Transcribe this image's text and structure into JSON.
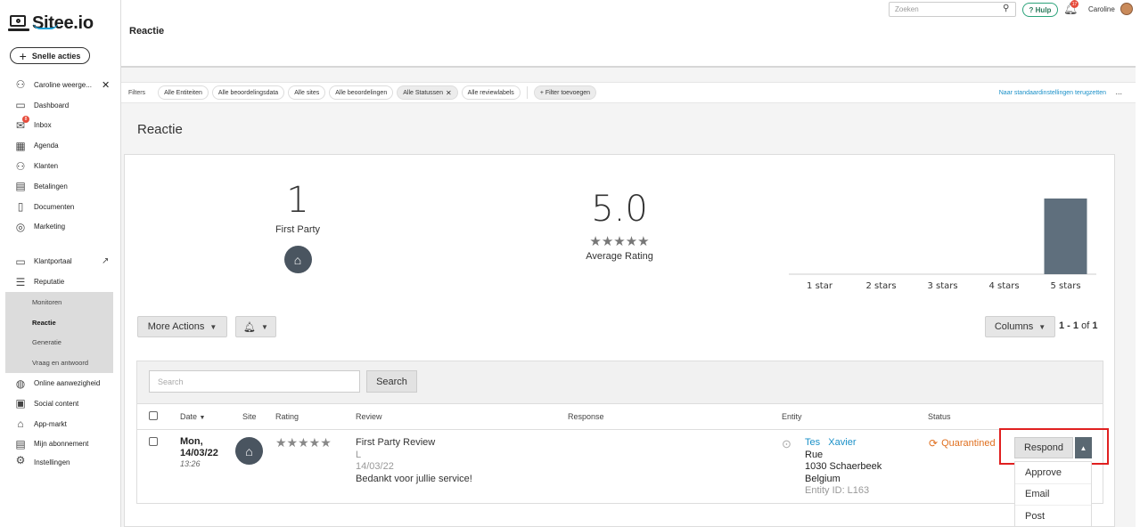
{
  "brand": {
    "name": "Sitee.io"
  },
  "sidebar": {
    "quick_actions": "Snelle acties",
    "items": [
      {
        "label": "Caroline weerge...",
        "icon": "user-icon"
      },
      {
        "label": "Dashboard",
        "icon": "dashboard-icon"
      },
      {
        "label": "Inbox",
        "icon": "inbox-icon"
      },
      {
        "label": "Agenda",
        "icon": "calendar-icon"
      },
      {
        "label": "Klanten",
        "icon": "users-icon"
      },
      {
        "label": "Betalingen",
        "icon": "payments-icon"
      },
      {
        "label": "Documenten",
        "icon": "document-icon"
      },
      {
        "label": "Marketing",
        "icon": "marketing-icon"
      },
      {
        "label": "Klantportaal",
        "icon": "portal-icon"
      },
      {
        "label": "Reputatie",
        "icon": "reputation-icon"
      },
      {
        "label": "Monitoren"
      },
      {
        "label": "Reactie"
      },
      {
        "label": "Generatie"
      },
      {
        "label": "Vraag en antwoord"
      },
      {
        "label": "Online aanwezigheid",
        "icon": "globe-icon"
      },
      {
        "label": "Social content",
        "icon": "social-icon"
      },
      {
        "label": "App-markt",
        "icon": "store-icon"
      },
      {
        "label": "Mijn abonnement",
        "icon": "subscription-icon"
      },
      {
        "label": "Instellingen",
        "icon": "settings-icon"
      }
    ],
    "inbox_badge": "8"
  },
  "topbar": {
    "search_placeholder": "Zoeken",
    "help": "? Hulp",
    "notif_count": "17",
    "user": "Caroline"
  },
  "page": {
    "header_title": "Reactie",
    "title": "Reactie"
  },
  "filters": {
    "label": "Filters",
    "chips": [
      "Alle Entiteiten",
      "Alle beoordelingsdata",
      "Alle sites",
      "Alle beoordelingen",
      "Alle Statussen",
      "Alle reviewlabels"
    ],
    "add": "+ Filter toevoegen",
    "reset": "Naar standaardinstellingen terugzetten",
    "more": "..."
  },
  "stats": {
    "count": "1",
    "count_label": "First Party",
    "rating": "5.0",
    "rating_stars": "★★★★★",
    "rating_label": "Average Rating"
  },
  "chart_data": {
    "type": "bar",
    "categories": [
      "1 star",
      "2 stars",
      "3 stars",
      "4 stars",
      "5 stars"
    ],
    "values": [
      0,
      0,
      0,
      0,
      1
    ],
    "title": "",
    "xlabel": "",
    "ylabel": "",
    "ylim": [
      0,
      1
    ],
    "color": "#5f6f7d",
    "grid": false
  },
  "toolbar": {
    "more_actions": "More Actions",
    "columns": "Columns",
    "pager_range": "1 - 1",
    "pager_of": "of",
    "pager_total": "1"
  },
  "table": {
    "search_placeholder": "Search",
    "search_button": "Search",
    "headers": {
      "date": "Date",
      "site": "Site",
      "rating": "Rating",
      "review": "Review",
      "response": "Response",
      "entity": "Entity",
      "status": "Status"
    },
    "rows": [
      {
        "date_day": "Mon,",
        "date_date": "14/03/22",
        "time": "13:26",
        "stars": "★★★★★",
        "review_title": "First Party Review",
        "review_author": "L",
        "review_date": "14/03/22",
        "review_text": "Bedankt voor jullie service!",
        "entity_name_a": "Tes",
        "entity_name_b": "Xavier",
        "entity_street": "Rue",
        "entity_city": "1030 Schaerbeek",
        "entity_country": "Belgium",
        "entity_id": "Entity ID: L163",
        "status": "Quarantined",
        "action": "Respond"
      }
    ],
    "menu": [
      "Approve",
      "Email",
      "Post"
    ]
  }
}
